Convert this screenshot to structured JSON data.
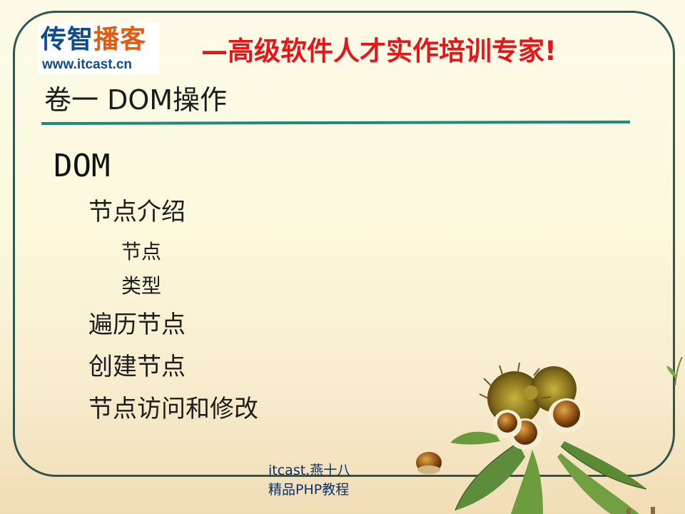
{
  "header": {
    "logo_top_1": "传智",
    "logo_top_2": "播客",
    "logo_bottom": "www.itcast.cn",
    "slogan": "—高级软件人才实作培训专家!"
  },
  "slide": {
    "title": "卷一 DOM操作",
    "heading": "DOM",
    "items": [
      "节点介绍",
      "节点",
      "类型",
      "遍历节点",
      "创建节点",
      "节点访问和修改"
    ]
  },
  "footer": {
    "line1": "itcast,燕十八",
    "line2": "精品PHP教程"
  },
  "colors": {
    "brand_blue": "#0b4d8f",
    "brand_orange": "#e05c10",
    "slogan_red": "#e8141a",
    "rule_teal": "#1e8a7c",
    "frame": "#2f5651"
  }
}
